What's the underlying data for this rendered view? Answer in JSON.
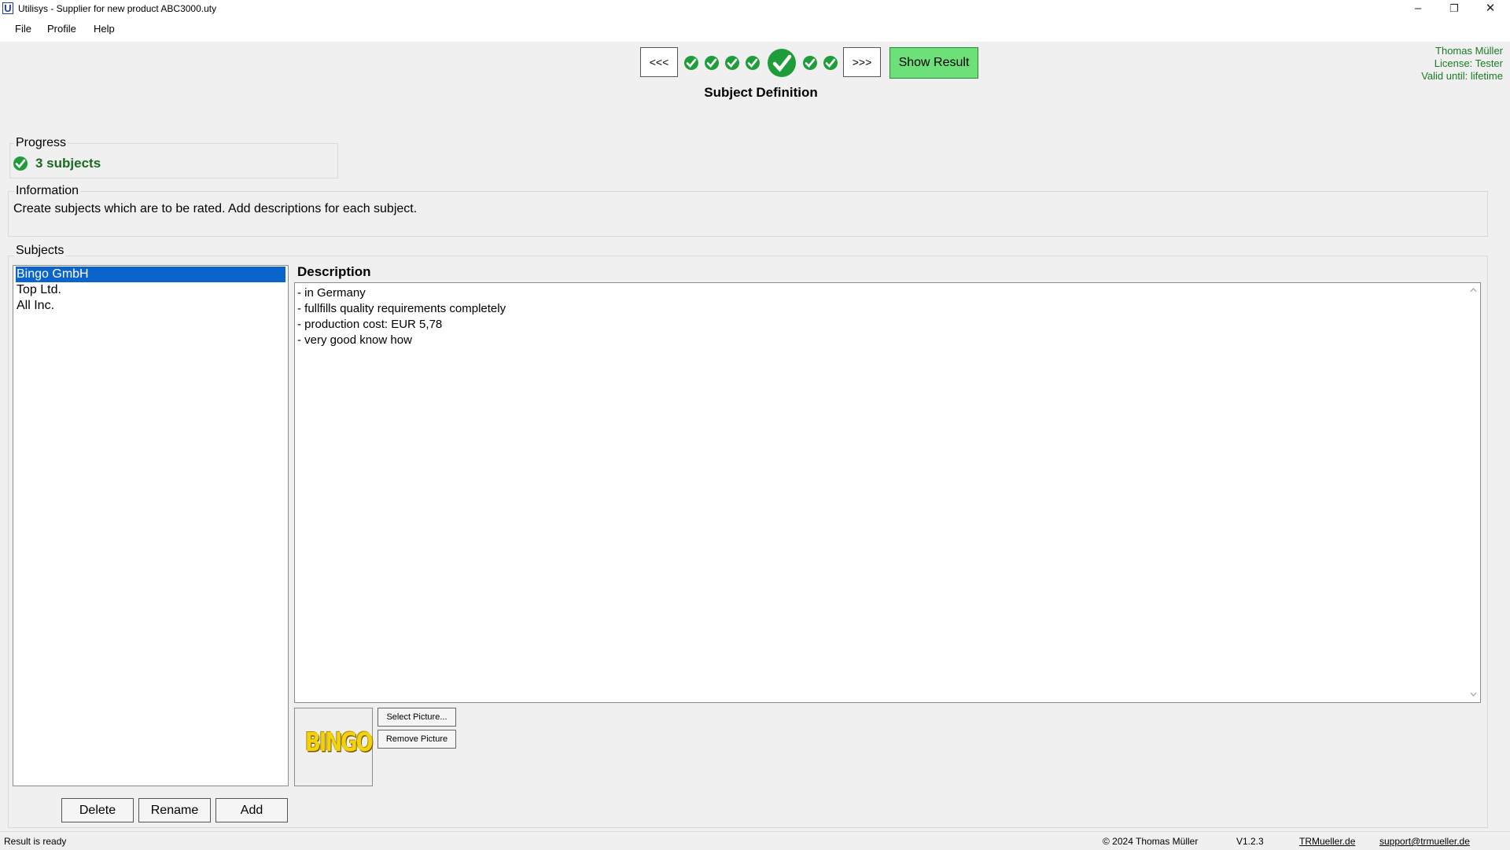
{
  "window": {
    "title": "Utilisys - Supplier for new product ABC3000.uty",
    "icon_letter": "U",
    "minimize": "–",
    "restore": "❐",
    "close": "✕"
  },
  "menu": [
    {
      "label": "File"
    },
    {
      "label": "Profile"
    },
    {
      "label": "Help"
    }
  ],
  "wizard": {
    "prev_label": "<<<",
    "next_label": ">>>",
    "show_result_label": "Show Result",
    "step_title": "Subject Definition",
    "steps_completed": 7,
    "current_step": 4
  },
  "user": {
    "name": "Thomas Müller",
    "license": "License: Tester",
    "valid": "Valid until: lifetime"
  },
  "progress": {
    "label": "Progress",
    "status": "3 subjects"
  },
  "information": {
    "label": "Information",
    "text": "Create subjects which are to be rated. Add descriptions for each subject."
  },
  "subjects": {
    "label": "Subjects",
    "items": [
      "Bingo GmbH",
      "Top Ltd.",
      "All Inc."
    ],
    "selected_index": 0,
    "delete_label": "Delete",
    "rename_label": "Rename",
    "add_label": "Add"
  },
  "description": {
    "label": "Description",
    "lines": [
      "- in Germany",
      "- fullfills quality requirements completely",
      "- production cost: EUR 5,78",
      "- very good know how"
    ]
  },
  "picture": {
    "logo_text": "BINGO",
    "select_label": "Select Picture...",
    "remove_label": "Remove Picture"
  },
  "statusbar": {
    "message": "Result is ready",
    "copyright": "© 2024 Thomas Müller",
    "version": "V1.2.3",
    "website": "TRMueller.de",
    "email": "support@trmueller.de"
  },
  "colors": {
    "accent_green": "#1f9d3a",
    "show_result_bg": "#6ee07a",
    "selection_blue": "#0a64cc",
    "user_text": "#1a7a22"
  }
}
